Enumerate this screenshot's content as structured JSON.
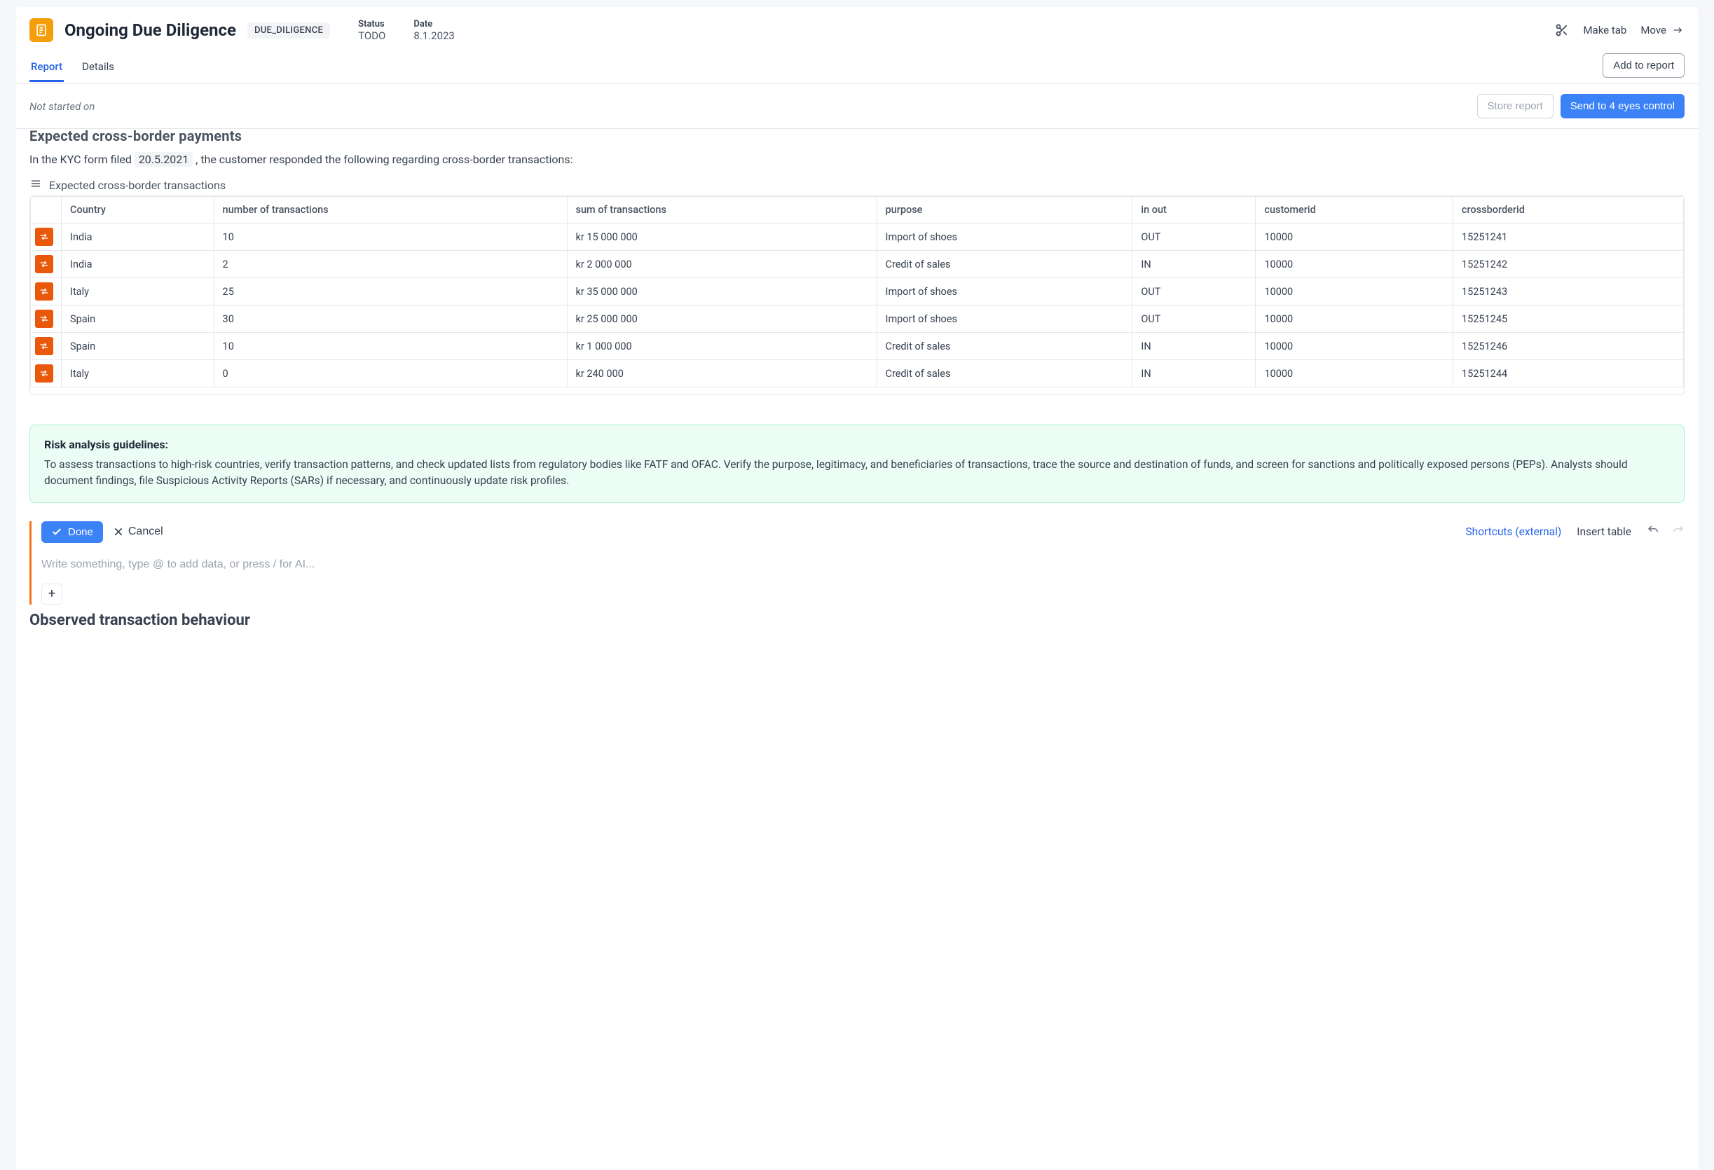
{
  "header": {
    "title": "Ongoing Due Diligence",
    "tag": "DUE_DILIGENCE",
    "status_label": "Status",
    "status_value": "TODO",
    "date_label": "Date",
    "date_value": "8.1.2023",
    "make_tab": "Make tab",
    "move": "Move"
  },
  "tabs": {
    "report": "Report",
    "details": "Details",
    "add_to_report": "Add to report"
  },
  "subheader": {
    "status_text": "Not started on",
    "store_report": "Store report",
    "send_control": "Send to 4 eyes control"
  },
  "section": {
    "heading_cut": "Expected cross-border payments",
    "kyc_prefix": "In the KYC form filed ",
    "kyc_date": "20.5.2021",
    "kyc_suffix": " , the customer responded the following regarding cross-border transactions:",
    "table_caption": "Expected cross-border transactions"
  },
  "table": {
    "headers": [
      "Country",
      "number of transactions",
      "sum of transactions",
      "purpose",
      "in out",
      "customerid",
      "crossborderid"
    ],
    "rows": [
      {
        "country": "India",
        "num": "10",
        "sum": "kr 15 000 000",
        "purpose": "Import of shoes",
        "inout": "OUT",
        "customerid": "10000",
        "crossborderid": "15251241"
      },
      {
        "country": "India",
        "num": "2",
        "sum": "kr 2 000 000",
        "purpose": "Credit of sales",
        "inout": "IN",
        "customerid": "10000",
        "crossborderid": "15251242"
      },
      {
        "country": "Italy",
        "num": "25",
        "sum": "kr 35 000 000",
        "purpose": "Import of shoes",
        "inout": "OUT",
        "customerid": "10000",
        "crossborderid": "15251243"
      },
      {
        "country": "Spain",
        "num": "30",
        "sum": "kr 25 000 000",
        "purpose": "Import of shoes",
        "inout": "OUT",
        "customerid": "10000",
        "crossborderid": "15251245"
      },
      {
        "country": "Spain",
        "num": "10",
        "sum": "kr 1 000 000",
        "purpose": "Credit of sales",
        "inout": "IN",
        "customerid": "10000",
        "crossborderid": "15251246"
      },
      {
        "country": "Italy",
        "num": "0",
        "sum": "kr 240 000",
        "purpose": "Credit of sales",
        "inout": "IN",
        "customerid": "10000",
        "crossborderid": "15251244"
      }
    ]
  },
  "guidelines": {
    "title": "Risk analysis guidelines:",
    "body": "To assess transactions to high-risk countries, verify transaction patterns, and check updated lists from regulatory bodies like FATF and OFAC. Verify the purpose, legitimacy, and beneficiaries of transactions, trace the source and destination of funds, and screen for sanctions and politically exposed persons (PEPs). Analysts should document findings, file Suspicious Activity Reports (SARs) if necessary, and continuously update risk profiles."
  },
  "editor": {
    "done": "Done",
    "cancel": "Cancel",
    "shortcuts": "Shortcuts (external)",
    "insert_table": "Insert table",
    "placeholder": "Write something, type @ to add data, or press / for AI..."
  },
  "observed_heading": "Observed transaction behaviour"
}
